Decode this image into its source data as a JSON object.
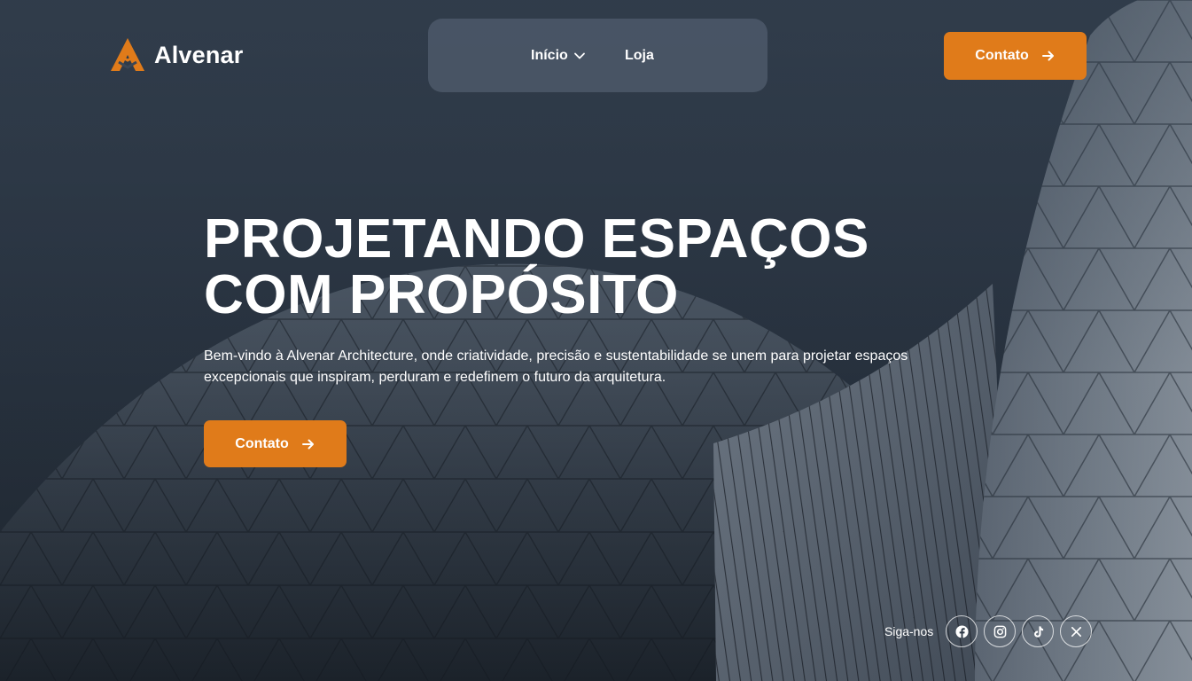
{
  "brand": {
    "name": "Alvenar",
    "accent_color": "#e07b1a"
  },
  "nav": {
    "items": [
      {
        "label": "Início",
        "has_dropdown": true
      },
      {
        "label": "Loja",
        "has_dropdown": false
      }
    ]
  },
  "header": {
    "cta_label": "Contato",
    "cta_icon": "arrow-right-icon"
  },
  "hero": {
    "headline_line1": "PROJETANDO ESPAÇOS",
    "headline_line2": "COM PROPÓSITO",
    "lead": "Bem-vindo à Alvenar Architecture, onde criatividade, precisão e sustentabilidade se unem para projetar espaços excepcionais que inspiram, perduram e redefinem o futuro da arquitetura.",
    "cta_label": "Contato",
    "cta_icon": "arrow-right-icon"
  },
  "social": {
    "label": "Siga-nos",
    "icons": [
      "facebook-icon",
      "instagram-icon",
      "tiktok-icon",
      "x-icon"
    ]
  }
}
